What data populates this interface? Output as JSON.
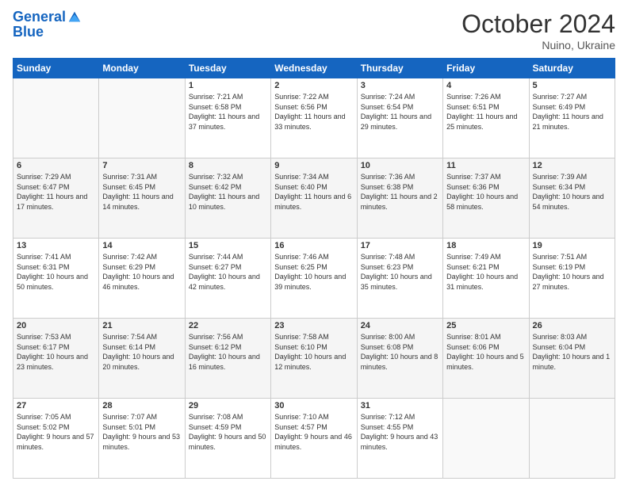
{
  "header": {
    "logo_line1": "General",
    "logo_line2": "Blue",
    "month_title": "October 2024",
    "subtitle": "Nuino, Ukraine"
  },
  "weekdays": [
    "Sunday",
    "Monday",
    "Tuesday",
    "Wednesday",
    "Thursday",
    "Friday",
    "Saturday"
  ],
  "weeks": [
    [
      {
        "day": "",
        "content": ""
      },
      {
        "day": "",
        "content": ""
      },
      {
        "day": "1",
        "content": "Sunrise: 7:21 AM\nSunset: 6:58 PM\nDaylight: 11 hours and 37 minutes."
      },
      {
        "day": "2",
        "content": "Sunrise: 7:22 AM\nSunset: 6:56 PM\nDaylight: 11 hours and 33 minutes."
      },
      {
        "day": "3",
        "content": "Sunrise: 7:24 AM\nSunset: 6:54 PM\nDaylight: 11 hours and 29 minutes."
      },
      {
        "day": "4",
        "content": "Sunrise: 7:26 AM\nSunset: 6:51 PM\nDaylight: 11 hours and 25 minutes."
      },
      {
        "day": "5",
        "content": "Sunrise: 7:27 AM\nSunset: 6:49 PM\nDaylight: 11 hours and 21 minutes."
      }
    ],
    [
      {
        "day": "6",
        "content": "Sunrise: 7:29 AM\nSunset: 6:47 PM\nDaylight: 11 hours and 17 minutes."
      },
      {
        "day": "7",
        "content": "Sunrise: 7:31 AM\nSunset: 6:45 PM\nDaylight: 11 hours and 14 minutes."
      },
      {
        "day": "8",
        "content": "Sunrise: 7:32 AM\nSunset: 6:42 PM\nDaylight: 11 hours and 10 minutes."
      },
      {
        "day": "9",
        "content": "Sunrise: 7:34 AM\nSunset: 6:40 PM\nDaylight: 11 hours and 6 minutes."
      },
      {
        "day": "10",
        "content": "Sunrise: 7:36 AM\nSunset: 6:38 PM\nDaylight: 11 hours and 2 minutes."
      },
      {
        "day": "11",
        "content": "Sunrise: 7:37 AM\nSunset: 6:36 PM\nDaylight: 10 hours and 58 minutes."
      },
      {
        "day": "12",
        "content": "Sunrise: 7:39 AM\nSunset: 6:34 PM\nDaylight: 10 hours and 54 minutes."
      }
    ],
    [
      {
        "day": "13",
        "content": "Sunrise: 7:41 AM\nSunset: 6:31 PM\nDaylight: 10 hours and 50 minutes."
      },
      {
        "day": "14",
        "content": "Sunrise: 7:42 AM\nSunset: 6:29 PM\nDaylight: 10 hours and 46 minutes."
      },
      {
        "day": "15",
        "content": "Sunrise: 7:44 AM\nSunset: 6:27 PM\nDaylight: 10 hours and 42 minutes."
      },
      {
        "day": "16",
        "content": "Sunrise: 7:46 AM\nSunset: 6:25 PM\nDaylight: 10 hours and 39 minutes."
      },
      {
        "day": "17",
        "content": "Sunrise: 7:48 AM\nSunset: 6:23 PM\nDaylight: 10 hours and 35 minutes."
      },
      {
        "day": "18",
        "content": "Sunrise: 7:49 AM\nSunset: 6:21 PM\nDaylight: 10 hours and 31 minutes."
      },
      {
        "day": "19",
        "content": "Sunrise: 7:51 AM\nSunset: 6:19 PM\nDaylight: 10 hours and 27 minutes."
      }
    ],
    [
      {
        "day": "20",
        "content": "Sunrise: 7:53 AM\nSunset: 6:17 PM\nDaylight: 10 hours and 23 minutes."
      },
      {
        "day": "21",
        "content": "Sunrise: 7:54 AM\nSunset: 6:14 PM\nDaylight: 10 hours and 20 minutes."
      },
      {
        "day": "22",
        "content": "Sunrise: 7:56 AM\nSunset: 6:12 PM\nDaylight: 10 hours and 16 minutes."
      },
      {
        "day": "23",
        "content": "Sunrise: 7:58 AM\nSunset: 6:10 PM\nDaylight: 10 hours and 12 minutes."
      },
      {
        "day": "24",
        "content": "Sunrise: 8:00 AM\nSunset: 6:08 PM\nDaylight: 10 hours and 8 minutes."
      },
      {
        "day": "25",
        "content": "Sunrise: 8:01 AM\nSunset: 6:06 PM\nDaylight: 10 hours and 5 minutes."
      },
      {
        "day": "26",
        "content": "Sunrise: 8:03 AM\nSunset: 6:04 PM\nDaylight: 10 hours and 1 minute."
      }
    ],
    [
      {
        "day": "27",
        "content": "Sunrise: 7:05 AM\nSunset: 5:02 PM\nDaylight: 9 hours and 57 minutes."
      },
      {
        "day": "28",
        "content": "Sunrise: 7:07 AM\nSunset: 5:01 PM\nDaylight: 9 hours and 53 minutes."
      },
      {
        "day": "29",
        "content": "Sunrise: 7:08 AM\nSunset: 4:59 PM\nDaylight: 9 hours and 50 minutes."
      },
      {
        "day": "30",
        "content": "Sunrise: 7:10 AM\nSunset: 4:57 PM\nDaylight: 9 hours and 46 minutes."
      },
      {
        "day": "31",
        "content": "Sunrise: 7:12 AM\nSunset: 4:55 PM\nDaylight: 9 hours and 43 minutes."
      },
      {
        "day": "",
        "content": ""
      },
      {
        "day": "",
        "content": ""
      }
    ]
  ]
}
